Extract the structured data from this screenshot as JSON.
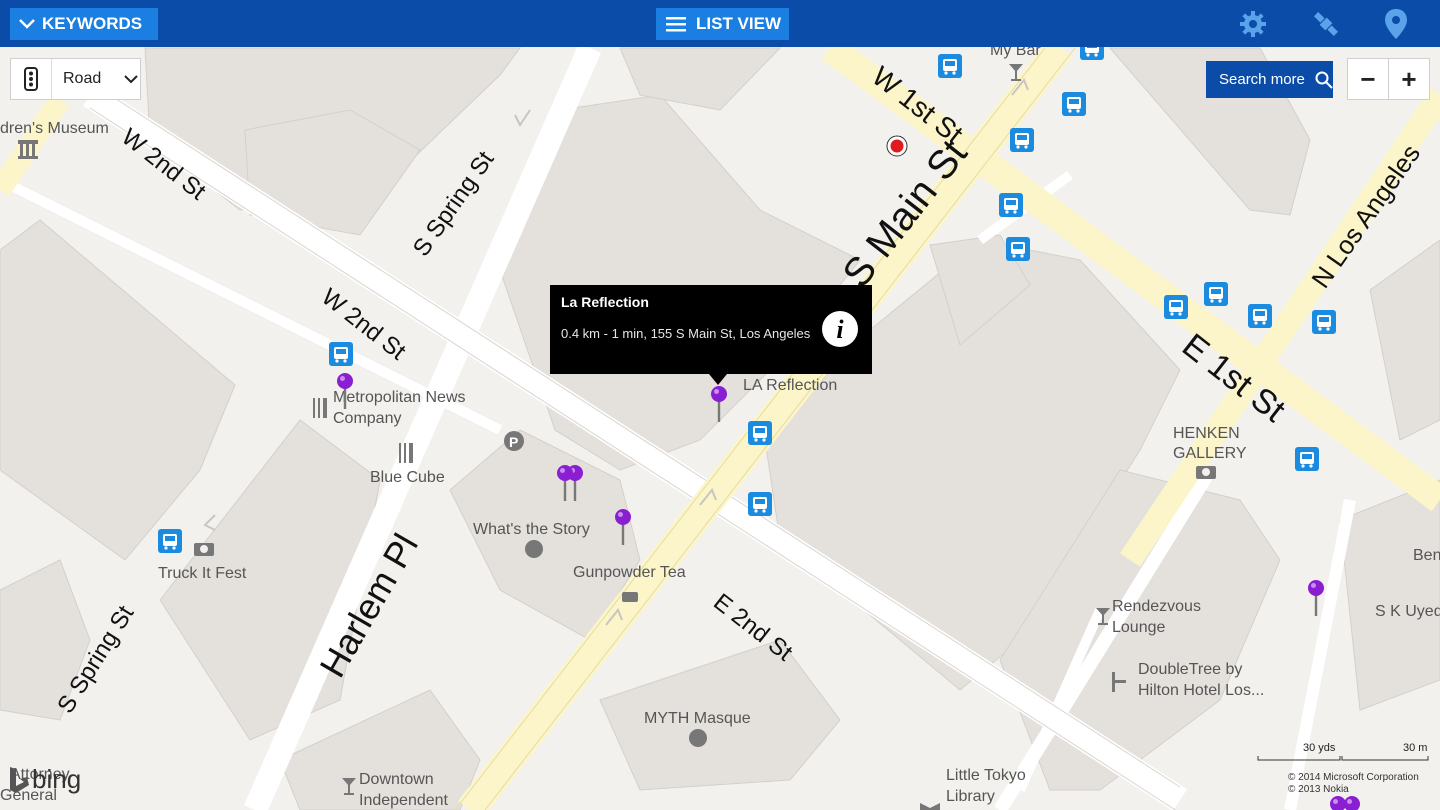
{
  "toolbar": {
    "keywords_label": "KEYWORDS",
    "list_view_label": "LIST VIEW",
    "icons": [
      "settings-gear-icon",
      "satellite-icon",
      "location-pin-icon"
    ]
  },
  "map_controls": {
    "style_label": "Road",
    "search_more_label": "Search more",
    "zoom_out": "−",
    "zoom_in": "+"
  },
  "callout": {
    "title": "La Reflection",
    "details": "0.4 km - 1 min, 155 S Main St, Los Angeles"
  },
  "streets": {
    "w1st": "W 1st St",
    "w2nd_top": "W 2nd St",
    "w2nd_mid": "W 2nd St",
    "spring_top": "S Spring St",
    "spring_bot": "S Spring St",
    "main": "S Main St",
    "e1st": "E 1st St",
    "la_st": "N Los Angeles",
    "harlem": "Harlem Pl",
    "e2nd": "E 2nd St"
  },
  "places": {
    "childrens_museum": "dren's Museum",
    "my_bar": "My Bar",
    "la_reflection": "LA Reflection",
    "metro_news_1": "Metropolitan News",
    "metro_news_2": "Company",
    "blue_cube": "Blue Cube",
    "whats_story": "What's the Story",
    "gunpowder": "Gunpowder Tea",
    "truck": "Truck It Fest",
    "henken_1": "HENKEN",
    "henken_2": "GALLERY",
    "rendezvous_1": "Rendezvous",
    "rendezvous_2": "Lounge",
    "doubletree_1": "DoubleTree by",
    "doubletree_2": "Hilton Hotel Los...",
    "skuyed": "S K Uyed",
    "ben": "Ben",
    "myth": "MYTH Masque",
    "downtown_1": "Downtown",
    "downtown_2": "Independent",
    "little_tokyo_1": "Little Tokyo",
    "little_tokyo_2": "Library",
    "attorney_1": "Attorney",
    "attorney_2": "General"
  },
  "scale": {
    "yards": "30 yds",
    "meters": "30 m"
  },
  "attribution": {
    "line1": "© 2014 Microsoft Corporation",
    "line2": "© 2013 Nokia"
  },
  "logo_text": "bing",
  "colors": {
    "toolbar_bg": "#0a4ca8",
    "button_bg": "#1a7fe0",
    "map_bg": "#f3f1ee",
    "building": "#e2dfdb",
    "main_road": "#fbf5c9",
    "pin": "#8a1fd1",
    "transit": "#1b8be0",
    "current_location": "#e3191e"
  }
}
